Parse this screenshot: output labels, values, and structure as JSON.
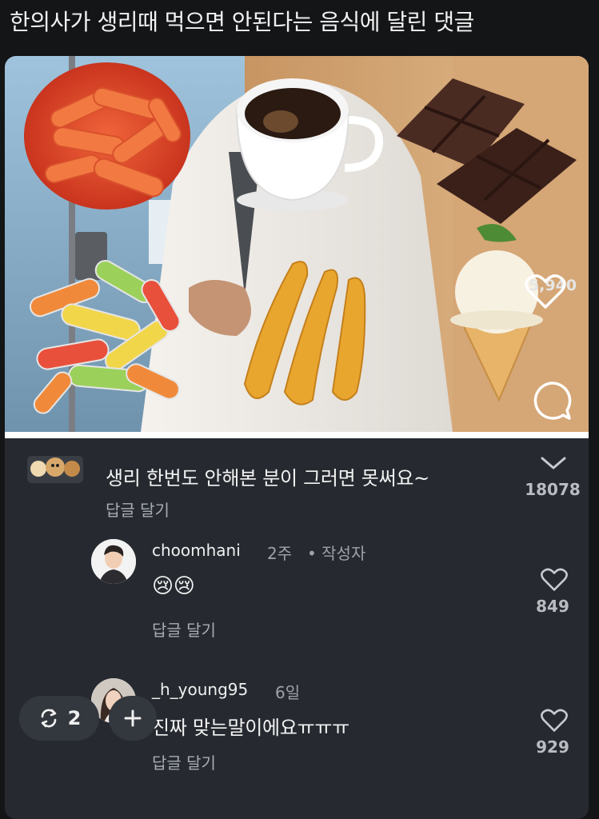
{
  "post": {
    "title": "한의사가 생리때 먹으면 안된다는 음식에 달린 댓글"
  },
  "media": {
    "like_count": "5,940",
    "icons": [
      "heart-icon",
      "comment-icon"
    ]
  },
  "comments": [
    {
      "text": "생리 한번도 안해본 분이 그러면 못써요~",
      "reply_label": "답글 달기",
      "likes": "18078",
      "like_icon": "chevron-down-icon"
    },
    {
      "username": "choomhani",
      "time": "2주",
      "author_badge": "• 작성자",
      "emoji": "😢😢",
      "reply_label": "답글 달기",
      "likes": "849",
      "like_icon": "heart-icon"
    },
    {
      "username": "_h_young95",
      "time": "6일",
      "text": "진짜 맞는말이에요ㅠㅠㅠ",
      "reply_label": "답글 달기",
      "likes": "929",
      "like_icon": "heart-icon"
    }
  ],
  "floating": {
    "repost_count": "2",
    "icons": [
      "repost-icon",
      "plus-icon"
    ]
  },
  "colors": {
    "background": "#141517",
    "card": "#262a30",
    "text": "#f3f3f3",
    "muted": "#9ea3a9"
  }
}
